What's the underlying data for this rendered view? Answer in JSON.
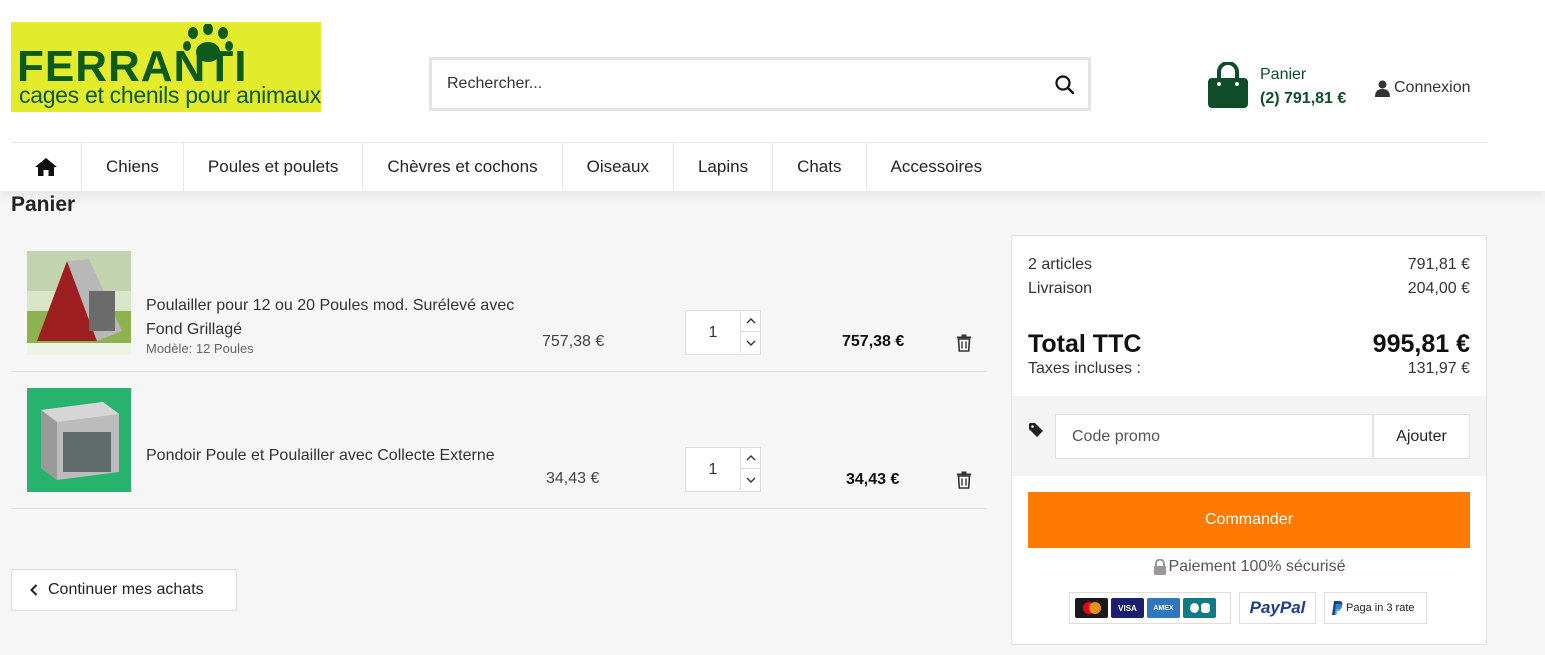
{
  "header": {
    "logo_title": "FERRANTI",
    "logo_subtitle": "cages et chenils pour animaux",
    "search_placeholder": "Rechercher...",
    "cart_label": "Panier",
    "cart_summary": "(2) 791,81 €",
    "login_label": "Connexion",
    "colors": {
      "logo_bg": "#e3ec2c",
      "logo_text": "#0c5a1c",
      "cart_green": "#0e4d27"
    }
  },
  "nav": {
    "home_icon": "home-icon",
    "items": [
      "Chiens",
      "Poules et poulets",
      "Chèvres et cochons",
      "Oiseaux",
      "Lapins",
      "Chats",
      "Accessoires"
    ]
  },
  "page": {
    "title": "Panier"
  },
  "cart": {
    "items": [
      {
        "name": "Poulailler pour 12 ou 20 Poules mod. Surélevé avec Fond Grillagé",
        "attribute": "Modèle: 12 Poules",
        "unit_price": "757,38 €",
        "quantity": "1",
        "total": "757,38 €"
      },
      {
        "name": "Pondoir Poule et Poulailler avec Collecte Externe",
        "attribute": "",
        "unit_price": "34,43 €",
        "quantity": "1",
        "total": "34,43 €"
      }
    ],
    "continue_label": "Continuer mes achats"
  },
  "summary": {
    "articles_label": "2 articles",
    "articles_value": "791,81 €",
    "shipping_label": "Livraison",
    "shipping_value": "204,00 €",
    "total_label": "Total TTC",
    "total_value": "995,81 €",
    "taxes_label": "Taxes incluses :",
    "taxes_value": "131,97 €",
    "promo_placeholder": "Code promo",
    "promo_button": "Ajouter",
    "order_button": "Commander",
    "secure_text": "Paiement 100% sécurisé",
    "cards": {
      "visa": "VISA",
      "amex": "AMEX"
    },
    "paypal": "PayPal",
    "paypal_installments": "Paga in 3 rate",
    "colors": {
      "order_button": "#ff7a00"
    }
  }
}
